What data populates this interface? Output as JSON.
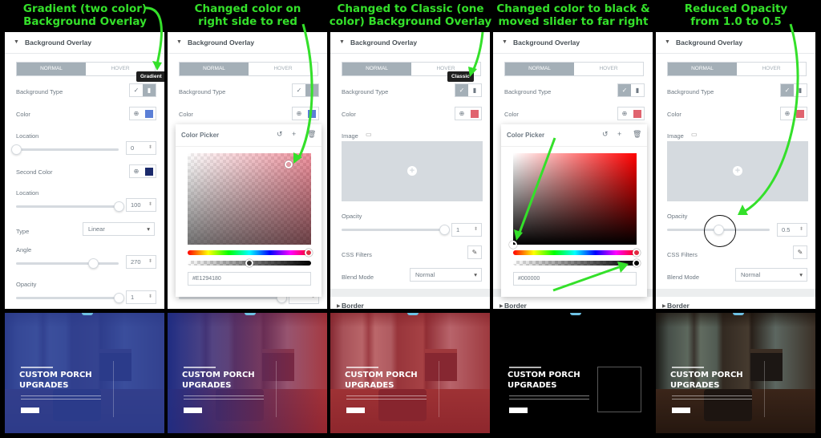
{
  "captions": [
    "Gradient (two color)\nBackground Overlay",
    "Changed color on\nright side to red",
    "Changed to Classic (one\ncolor) Background Overlay",
    "Changed color to black &\nmoved slider to far right",
    "Reduced Opacity\nfrom 1.0 to 0.5"
  ],
  "colors": {
    "annotation": "#34e02a",
    "accent_gray": "#a4afb7",
    "blue_overlay": "#2b3f9e",
    "red_overlay": "#e12941",
    "navy": "#1b2a6b"
  },
  "common": {
    "section_title": "Background Overlay",
    "tab_normal": "NORMAL",
    "tab_hover": "HOVER",
    "background_type_label": "Background Type",
    "color_label": "Color",
    "image_label": "Image",
    "opacity_label": "Opacity",
    "css_filters_label": "CSS Filters",
    "blend_mode_label": "Blend Mode",
    "blend_mode_value": "Normal",
    "border_section": "Border",
    "color_picker_title": "Color Picker"
  },
  "panel1": {
    "tooltip": "Gradient",
    "location_label": "Location",
    "location_value": "0",
    "second_color_label": "Second Color",
    "location2_label": "Location",
    "location2_value": "100",
    "type_label": "Type",
    "type_value": "Linear",
    "angle_label": "Angle",
    "angle_value": "270",
    "opacity_value": "1"
  },
  "panel2": {
    "hex_value": "#E1294180"
  },
  "panel3": {
    "tooltip": "Classic",
    "opacity_value": "1"
  },
  "panel4": {
    "hex_value": "#000000"
  },
  "panel5": {
    "opacity_value": "0.5",
    "opacity_fraction": 0.5
  },
  "hero": {
    "title": "CUSTOM PORCH\nUPGRADES"
  }
}
